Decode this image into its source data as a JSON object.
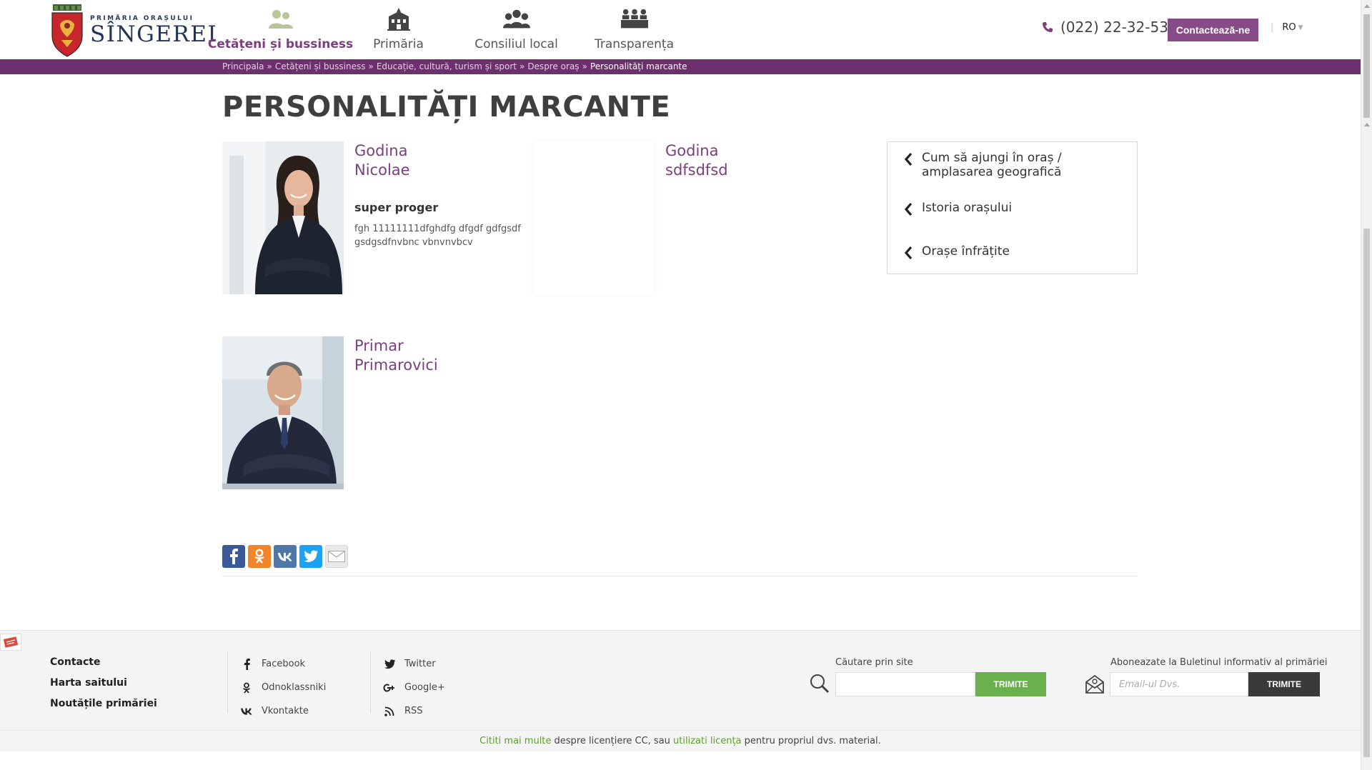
{
  "header": {
    "logo_small": "PRIMĂRIA ORAȘULUI",
    "logo_big": "SÎNGEREI",
    "nav": [
      {
        "label": "Cetățeni și bussiness",
        "icon": "citizens-icon",
        "active": true
      },
      {
        "label": "Primăria",
        "icon": "city-hall-icon",
        "active": false
      },
      {
        "label": "Consiliul local",
        "icon": "council-icon",
        "active": false
      },
      {
        "label": "Transparența",
        "icon": "transparency-icon",
        "active": false
      }
    ],
    "phone": "(022) 22-32-53",
    "contact_button": "Contactează-ne",
    "language": "RO"
  },
  "breadcrumb": {
    "items": [
      "Principala",
      "Cetățeni și bussiness",
      "Educație, cultură, turism și sport",
      "Despre oraș"
    ],
    "separator": "»",
    "current": "Personalități marcante"
  },
  "page": {
    "title": "PERSONALITĂȚI MARCANTE"
  },
  "personalities": [
    {
      "name_first": "Godina",
      "name_last": "Nicolae",
      "role": "super proger",
      "description": "fgh 11111111dfghdfg dfgdf gdfgsdf gsdgsdfnvbnc vbnvnvbcv",
      "photo": "woman-portrait"
    },
    {
      "name_first": "Godina",
      "name_last": "sdfsdfsd",
      "role": "",
      "description": "",
      "photo": "blank"
    },
    {
      "name_first": "Primar",
      "name_last": "Primarovici",
      "role": "",
      "description": "",
      "photo": "man-portrait"
    }
  ],
  "sidebar": {
    "links": [
      {
        "line1": "Cum să ajungi în oraș /",
        "line2": "amplasarea geografică"
      },
      {
        "line1": "Istoria orașului",
        "line2": ""
      },
      {
        "line1": "Orașe înfrățite",
        "line2": ""
      }
    ]
  },
  "share": {
    "buttons": [
      {
        "name": "facebook-share-icon",
        "color": "#3b5998"
      },
      {
        "name": "odnoklassniki-share-icon",
        "color": "#f2842a"
      },
      {
        "name": "vkontakte-share-icon",
        "color": "#4f77a8"
      },
      {
        "name": "twitter-share-icon",
        "color": "#1da1f2"
      },
      {
        "name": "email-share-icon",
        "color": "#e9e9e9"
      }
    ]
  },
  "footer": {
    "links": [
      "Contacte",
      "Harta saitului",
      "Noutățile primăriei"
    ],
    "social_col1": [
      "Facebook",
      "Odnoklassniki",
      "Vkontakte"
    ],
    "social_col2": [
      "Twitter",
      "Google+",
      "RSS"
    ],
    "search_label": "Căutare prin site",
    "search_button": "TRIMITE",
    "newsletter_label": "Aboneazate la Buletinul informativ al primăriei",
    "newsletter_placeholder": "Email-ul Dvs.",
    "newsletter_button": "TRIMITE"
  },
  "license": {
    "link1": "Cititi mai multe",
    "text1": " despre licențiere CC, sau ",
    "link2": "utilizati licența",
    "text2": " pentru propriul dvs. material."
  },
  "colors": {
    "brand_purple": "#7b3f7e",
    "breadcrumb_bar": "#6e2f6e",
    "button_green": "#6ab04c",
    "button_dark": "#3a3a3a"
  }
}
